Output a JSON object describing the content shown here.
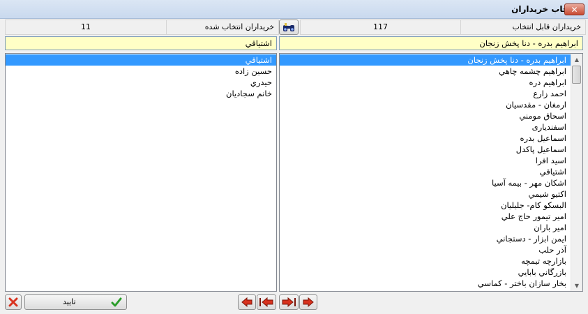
{
  "window": {
    "title": "انتخاب خریداران"
  },
  "header": {
    "available_label": "خریداران قابل انتخاب",
    "available_count": "117",
    "selected_label": "خریداران انتخاب شده",
    "selected_count": "11"
  },
  "right_panel": {
    "search_value": "ابراهيم بدره - دنا پخش زنجان",
    "items": [
      "ابراهيم بدره - دنا پخش زنجان",
      "ابراهيم چشمه چاهي",
      "ابراهيم دره",
      "احمد زارع",
      "ارمغان - مقدسيان",
      "اسحاق مومني",
      "اسفنديارى",
      "اسماعيل بدره",
      "اسماعيل پاكدل",
      "اسيد افرا",
      "اشتياقي",
      "اشكان مهر - بيمه آسيا",
      "اكتيو شيمي",
      "البسكو كام- جليليان",
      "امير تيمور حاج علي",
      "امير باران",
      "ايمن ابزار - دستجاني",
      "آذر حلب",
      "بازارچه تيمچه",
      "بازرگاني بابايي",
      "بخار سازان باختر - كماسي"
    ],
    "selected_index": 0
  },
  "left_panel": {
    "search_value": "اشتياقي",
    "items": [
      "اشتياقي",
      "حسين زاده",
      "حيدري",
      "خانم سجاديان"
    ],
    "selected_index": 0
  },
  "footer": {
    "confirm_label": "تاييد"
  },
  "colors": {
    "selection": "#3399ff",
    "field_bg": "#ffffc6",
    "arrow_red": "#d8321e",
    "check_green": "#2a9d2a"
  },
  "icons": {
    "close": "close-icon",
    "search": "binoculars-icon",
    "cancel": "red-x-icon",
    "confirm": "checkmark-icon",
    "move_one_left": "arrow-left-icon",
    "move_all_left": "arrow-left-bar-icon",
    "move_all_right": "arrow-right-bar-icon",
    "move_one_right": "arrow-right-icon"
  }
}
